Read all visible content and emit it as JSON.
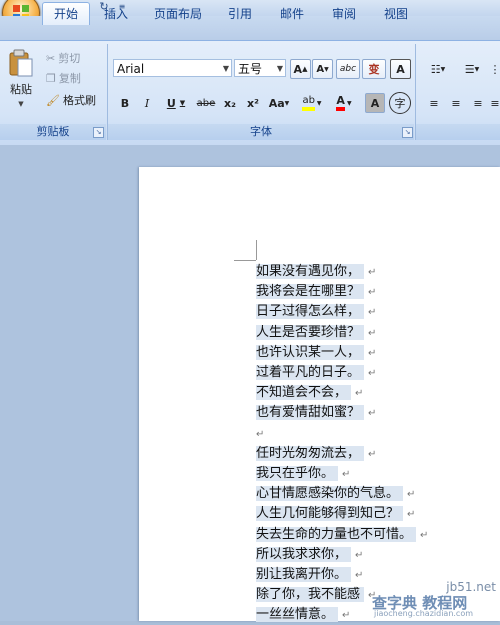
{
  "tabs": [
    {
      "label": "开始"
    },
    {
      "label": "插入"
    },
    {
      "label": "页面布局"
    },
    {
      "label": "引用"
    },
    {
      "label": "邮件"
    },
    {
      "label": "审阅"
    },
    {
      "label": "视图"
    }
  ],
  "clipboard": {
    "paste_label": "粘贴",
    "cut_label": "剪切",
    "copy_label": "复制",
    "format_painter_label": "格式刷",
    "group_label": "剪贴板"
  },
  "font": {
    "font_name": "Arial",
    "font_size": "五号",
    "grow_label": "A",
    "shrink_label": "A",
    "phonetic_label": "abc",
    "char_border_label": "A",
    "wen_label": "变",
    "bold": "B",
    "italic": "I",
    "underline": "U",
    "strike": "abe",
    "subscript": "x₂",
    "superscript": "x²",
    "change_case": "Aa",
    "highlight": "ab",
    "font_color": "A",
    "char_shading": "A",
    "enclose_char": "字",
    "group_label": "字体"
  },
  "document": {
    "lines": [
      "如果没有遇见你，",
      "我将会是在哪里？",
      "日子过得怎么样，",
      "人生是否要珍惜？",
      "也许认识某一人，",
      "过着平凡的日子。",
      "不知道会不会，",
      "也有爱情甜如蜜？",
      "",
      "任时光匆匆流去，",
      "我只在乎你。",
      "心甘情愿感染你的气息。",
      "人生几何能够得到知己？",
      "失去生命的力量也不可惜。",
      "所以我求求你，",
      "别让我离开你。",
      "除了你，我不能感",
      "一丝丝情意。"
    ],
    "paragraph_mark": "↵"
  },
  "watermark": {
    "site": "jb51.net",
    "text": "查字典 教程网",
    "small": "jiaocheng.chazidian.com"
  },
  "colors": {
    "highlight": "#ffff00",
    "font_color": "#ff0000",
    "selection": "#dbe5f1"
  }
}
